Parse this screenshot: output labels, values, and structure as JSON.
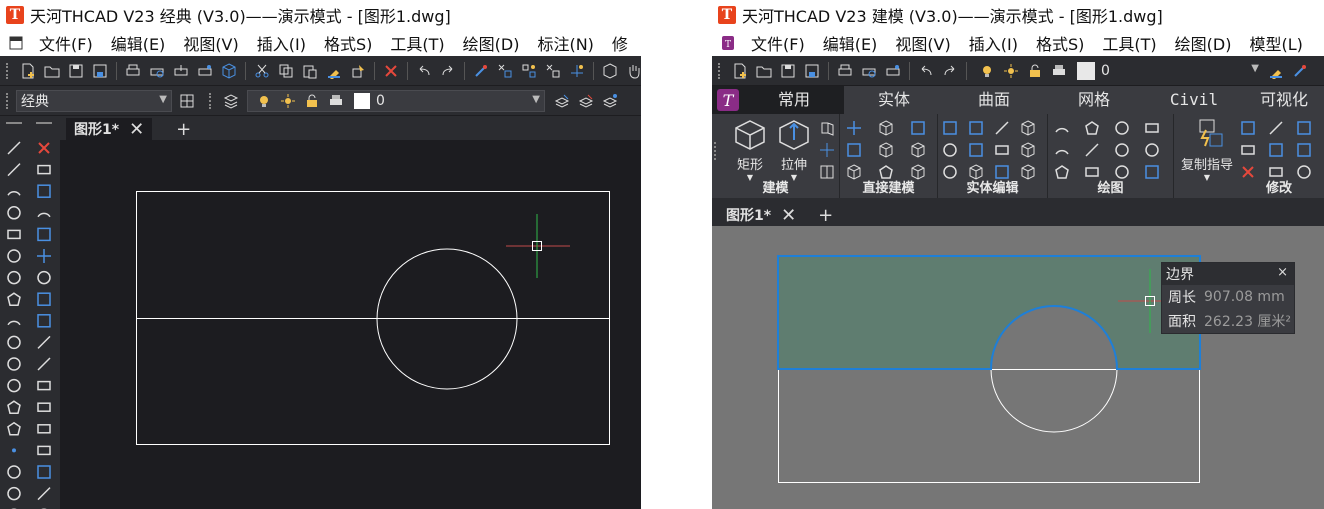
{
  "left": {
    "title": "天河THCAD V23 经典 (V3.0)——演示模式 - [图形1.dwg]",
    "app_logo": "T",
    "menu": [
      "文件(F)",
      "编辑(E)",
      "视图(V)",
      "插入(I)",
      "格式S)",
      "工具(T)",
      "绘图(D)",
      "标注(N)",
      "修"
    ],
    "workspace": "经典",
    "layer": "0",
    "doc_tab": "图形1*",
    "tab_close": "✕",
    "tab_add": "+"
  },
  "right": {
    "title": "天河THCAD V23 建模 (V3.0)——演示模式 - [图形1.dwg]",
    "app_logo": "T",
    "menu": [
      "文件(F)",
      "编辑(E)",
      "视图(V)",
      "插入(I)",
      "格式S)",
      "工具(T)",
      "绘图(D)",
      "模型(L)"
    ],
    "layer": "0",
    "ribbon_tabs": [
      "常用",
      "实体",
      "曲面",
      "网格",
      "Civil",
      "可视化"
    ],
    "ribbon_groups": [
      "建模",
      "直接建模",
      "实体编辑",
      "绘图",
      "修改"
    ],
    "big_buttons": [
      "矩形",
      "拉伸",
      "复制指导"
    ],
    "doc_tab": "图形1*",
    "tab_close": "✕",
    "tab_add": "+",
    "tooltip": {
      "title": "边界",
      "close": "×",
      "rows": [
        {
          "label": "周长",
          "value": "907.08 mm"
        },
        {
          "label": "面积",
          "value": "262.23 厘米²"
        }
      ]
    }
  },
  "colors": {
    "accent_blue": "#1e7fd8",
    "fill_green": "#5f7d70",
    "canvas_dark": "#1c1c20",
    "canvas_gray": "#767676",
    "logo_red": "#e8431c",
    "ribbon_logo_purple": "#8a2c86"
  }
}
